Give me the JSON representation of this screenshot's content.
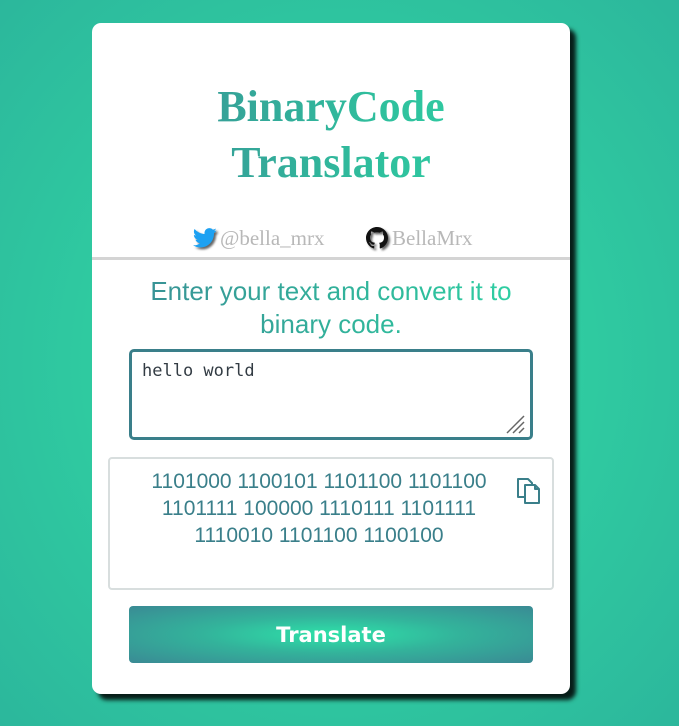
{
  "header": {
    "title_line1": "BinaryCode",
    "title_line2": "Translator"
  },
  "socials": {
    "twitter": {
      "handle": "@bella_mrx",
      "icon": "twitter-bird-icon"
    },
    "github": {
      "handle": "BellaMrx",
      "icon": "github-octocat-icon"
    }
  },
  "instructions": {
    "line1": "Enter your text and convert it to",
    "line2": "binary code."
  },
  "input": {
    "value": "hello world"
  },
  "output": {
    "line1": "1101000 1100101 1101100 1101100",
    "line2": "1101111 100000 1110111 1101111",
    "line3": "1110010 1101100 1100100",
    "copy_icon": "copy-icon"
  },
  "actions": {
    "translate_label": "Translate"
  },
  "colors": {
    "background_accent": "#2ee0a8",
    "primary_teal": "#3a7f8a",
    "card": "#ffffff",
    "muted_text": "#b8b8b8"
  }
}
